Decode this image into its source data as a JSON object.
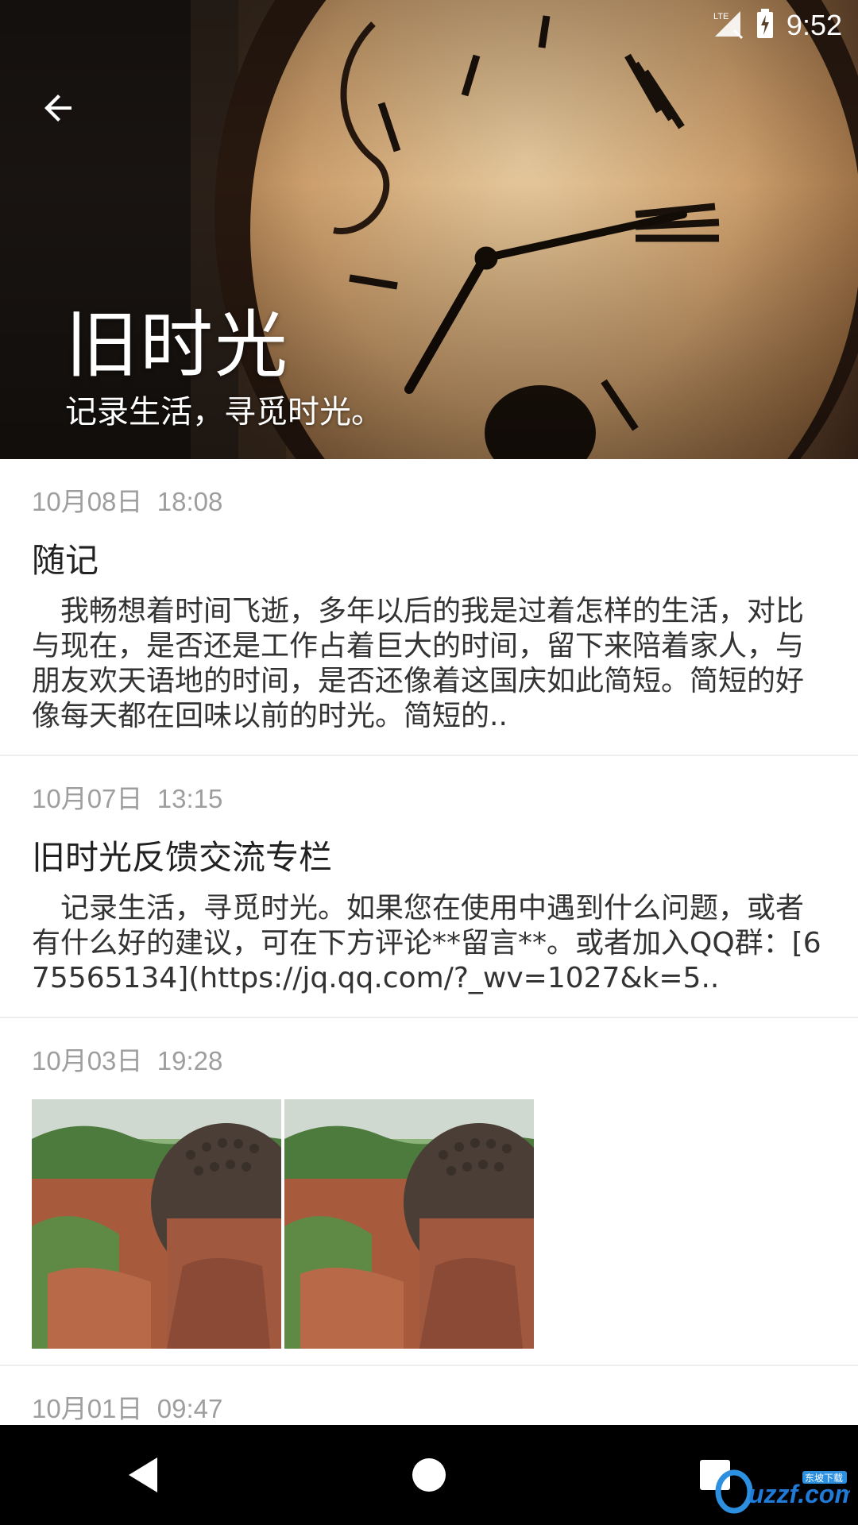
{
  "status": {
    "time": "9:52",
    "network_label": "LTE"
  },
  "header": {
    "title": "旧时光",
    "subtitle": "记录生活，寻觅时光。"
  },
  "posts": [
    {
      "date": "10月08日",
      "time": "18:08",
      "title": "随记",
      "body": "我畅想着时间飞逝，多年以后的我是过着怎样的生活，对比与现在，是否还是工作占着巨大的时间，留下来陪着家人，与朋友欢天语地的时间，是否还像着这国庆如此简短。简短的好像每天都在回味以前的时光。简短的.."
    },
    {
      "date": "10月07日",
      "time": "13:15",
      "title": "旧时光反馈交流专栏",
      "body": "记录生活，寻觅时光。如果您在使用中遇到什么问题，或者有什么好的建议，可在下方评论**留言**。或者加入QQ群：[675565134](https://jq.qq.com/?_wv=1027&k=5.."
    },
    {
      "date": "10月03日",
      "time": "19:28",
      "images": [
        "leshan-buddha-photo",
        "leshan-buddha-photo"
      ]
    },
    {
      "date": "10月01日",
      "time": "09:47"
    }
  ],
  "watermark": {
    "text": "uzzf.com",
    "tag": "东坡下载"
  },
  "colors": {
    "date": "#9e9e9e",
    "title": "#212121",
    "body": "#333333",
    "nav": "#000000"
  }
}
